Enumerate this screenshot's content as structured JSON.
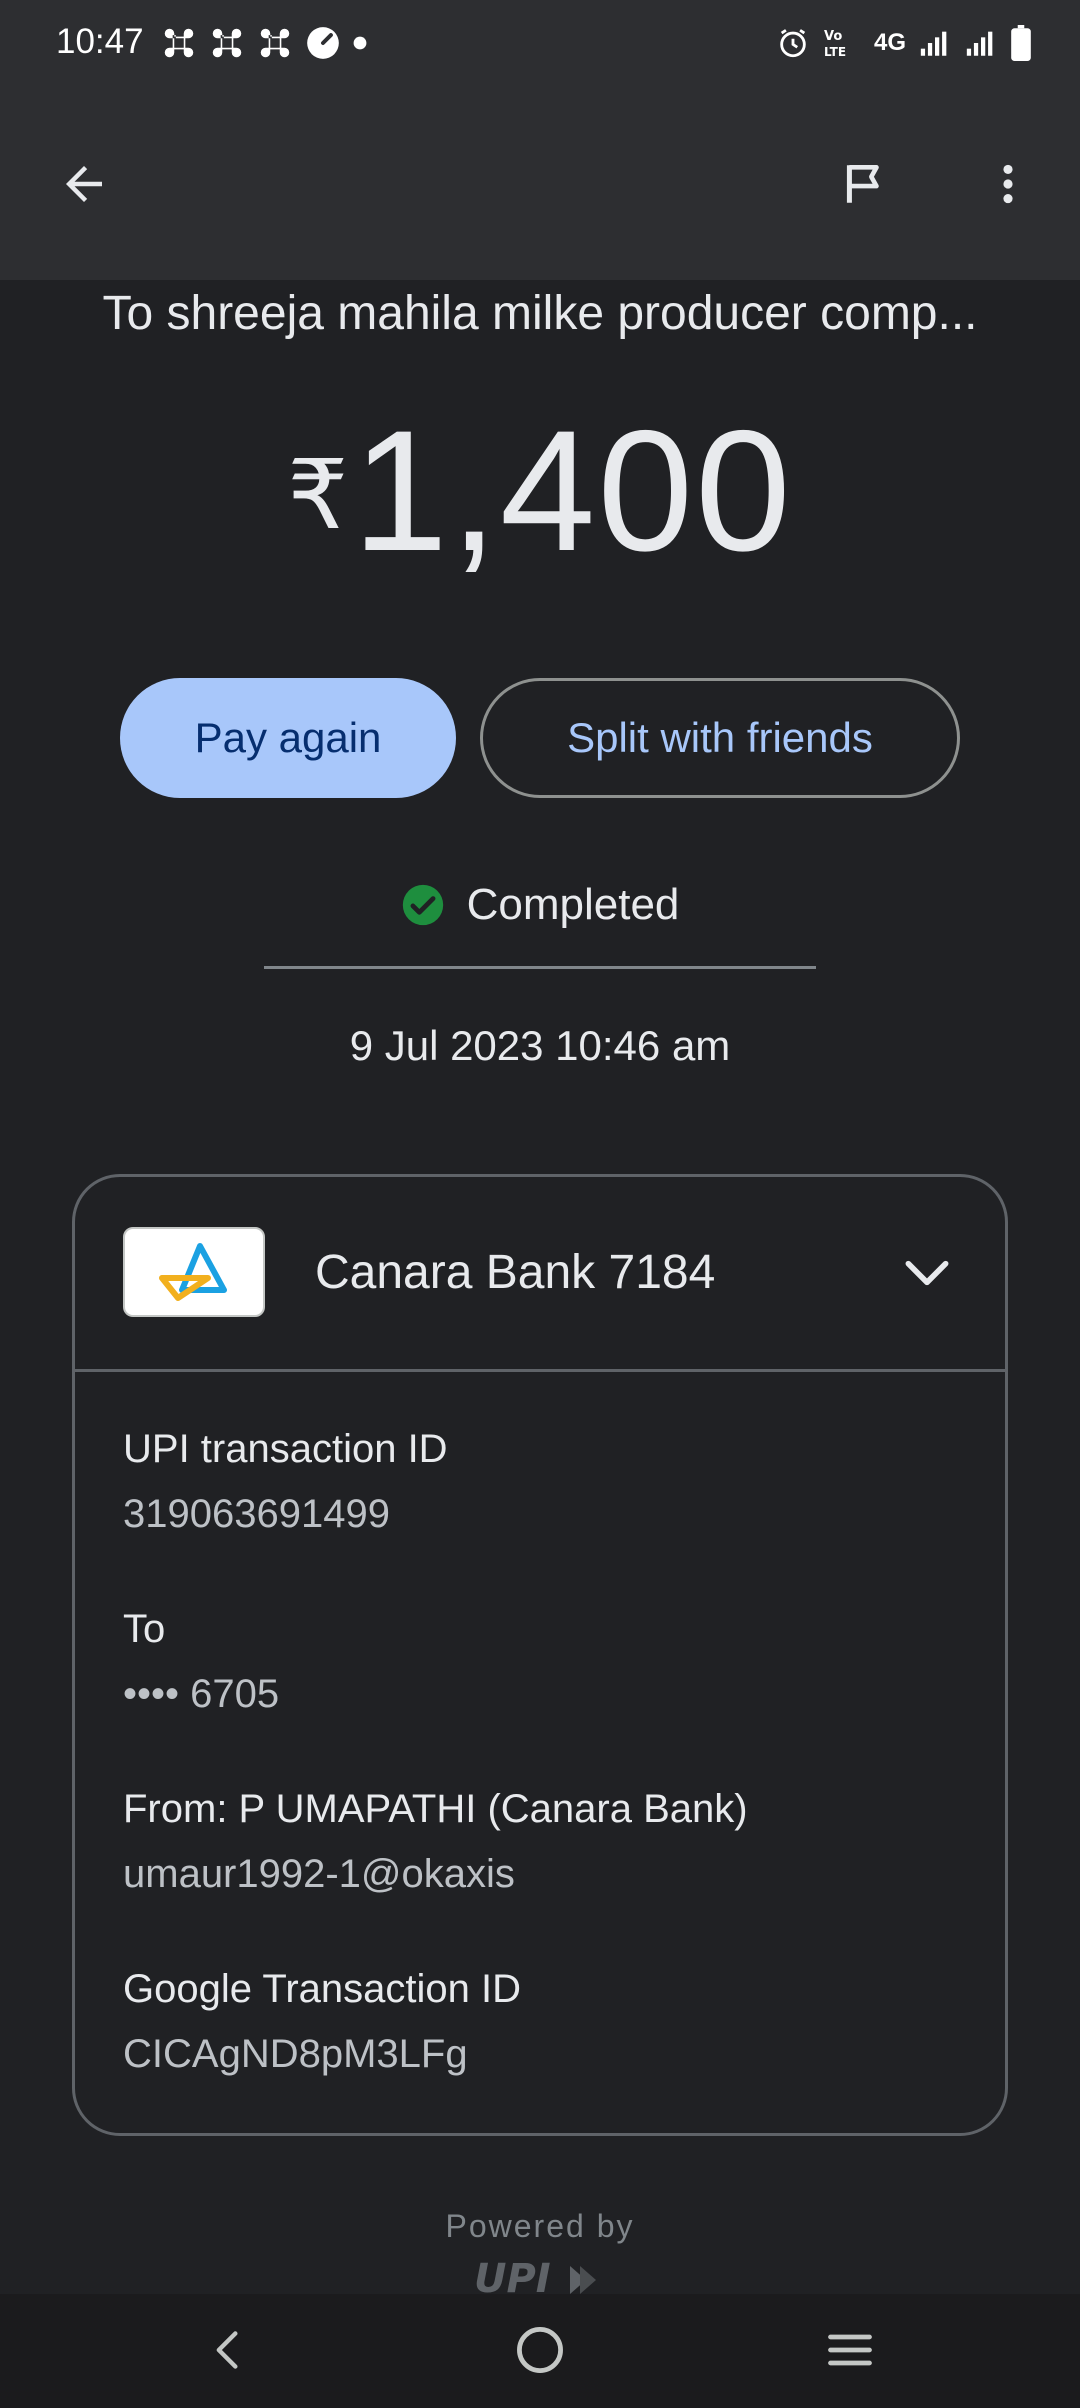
{
  "status_bar": {
    "time": "10:47",
    "network_label": "4G"
  },
  "header": {
    "back_icon": "arrow-left-icon",
    "flag_icon": "flag-icon",
    "more_icon": "more-vert-icon"
  },
  "payment": {
    "recipient": "To shreeja mahila milke producer comp...",
    "currency_symbol": "₹",
    "amount": "1,400",
    "pay_again_label": "Pay again",
    "split_label": "Split with friends",
    "status": "Completed",
    "status_color": "#1e8e3e",
    "datetime": "9 Jul 2023 10:46 am"
  },
  "details_card": {
    "bank_name": "Canara Bank 7184",
    "upi_txn_label": "UPI transaction ID",
    "upi_txn_value": "319063691499",
    "to_label": "To",
    "to_value": "•••• 6705",
    "from_label": "From: P  UMAPATHI (Canara Bank)",
    "from_value": "umaur1992-1@okaxis",
    "google_txn_label": "Google Transaction ID",
    "google_txn_value": "CICAgND8pM3LFg"
  },
  "footer": {
    "powered_by": "Powered by"
  },
  "colors": {
    "accent": "#a8c7fa",
    "background": "#202124",
    "app_bar": "#2d2e31"
  }
}
